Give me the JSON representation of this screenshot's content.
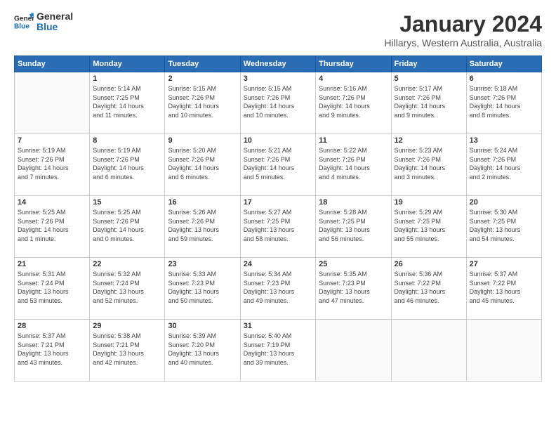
{
  "logo": {
    "line1": "General",
    "line2": "Blue"
  },
  "title": "January 2024",
  "subtitle": "Hillarys, Western Australia, Australia",
  "headers": [
    "Sunday",
    "Monday",
    "Tuesday",
    "Wednesday",
    "Thursday",
    "Friday",
    "Saturday"
  ],
  "weeks": [
    [
      {
        "day": "",
        "info": ""
      },
      {
        "day": "1",
        "info": "Sunrise: 5:14 AM\nSunset: 7:25 PM\nDaylight: 14 hours\nand 11 minutes."
      },
      {
        "day": "2",
        "info": "Sunrise: 5:15 AM\nSunset: 7:26 PM\nDaylight: 14 hours\nand 10 minutes."
      },
      {
        "day": "3",
        "info": "Sunrise: 5:15 AM\nSunset: 7:26 PM\nDaylight: 14 hours\nand 10 minutes."
      },
      {
        "day": "4",
        "info": "Sunrise: 5:16 AM\nSunset: 7:26 PM\nDaylight: 14 hours\nand 9 minutes."
      },
      {
        "day": "5",
        "info": "Sunrise: 5:17 AM\nSunset: 7:26 PM\nDaylight: 14 hours\nand 9 minutes."
      },
      {
        "day": "6",
        "info": "Sunrise: 5:18 AM\nSunset: 7:26 PM\nDaylight: 14 hours\nand 8 minutes."
      }
    ],
    [
      {
        "day": "7",
        "info": "Sunrise: 5:19 AM\nSunset: 7:26 PM\nDaylight: 14 hours\nand 7 minutes."
      },
      {
        "day": "8",
        "info": "Sunrise: 5:19 AM\nSunset: 7:26 PM\nDaylight: 14 hours\nand 6 minutes."
      },
      {
        "day": "9",
        "info": "Sunrise: 5:20 AM\nSunset: 7:26 PM\nDaylight: 14 hours\nand 6 minutes."
      },
      {
        "day": "10",
        "info": "Sunrise: 5:21 AM\nSunset: 7:26 PM\nDaylight: 14 hours\nand 5 minutes."
      },
      {
        "day": "11",
        "info": "Sunrise: 5:22 AM\nSunset: 7:26 PM\nDaylight: 14 hours\nand 4 minutes."
      },
      {
        "day": "12",
        "info": "Sunrise: 5:23 AM\nSunset: 7:26 PM\nDaylight: 14 hours\nand 3 minutes."
      },
      {
        "day": "13",
        "info": "Sunrise: 5:24 AM\nSunset: 7:26 PM\nDaylight: 14 hours\nand 2 minutes."
      }
    ],
    [
      {
        "day": "14",
        "info": "Sunrise: 5:25 AM\nSunset: 7:26 PM\nDaylight: 14 hours\nand 1 minute."
      },
      {
        "day": "15",
        "info": "Sunrise: 5:25 AM\nSunset: 7:26 PM\nDaylight: 14 hours\nand 0 minutes."
      },
      {
        "day": "16",
        "info": "Sunrise: 5:26 AM\nSunset: 7:26 PM\nDaylight: 13 hours\nand 59 minutes."
      },
      {
        "day": "17",
        "info": "Sunrise: 5:27 AM\nSunset: 7:25 PM\nDaylight: 13 hours\nand 58 minutes."
      },
      {
        "day": "18",
        "info": "Sunrise: 5:28 AM\nSunset: 7:25 PM\nDaylight: 13 hours\nand 56 minutes."
      },
      {
        "day": "19",
        "info": "Sunrise: 5:29 AM\nSunset: 7:25 PM\nDaylight: 13 hours\nand 55 minutes."
      },
      {
        "day": "20",
        "info": "Sunrise: 5:30 AM\nSunset: 7:25 PM\nDaylight: 13 hours\nand 54 minutes."
      }
    ],
    [
      {
        "day": "21",
        "info": "Sunrise: 5:31 AM\nSunset: 7:24 PM\nDaylight: 13 hours\nand 53 minutes."
      },
      {
        "day": "22",
        "info": "Sunrise: 5:32 AM\nSunset: 7:24 PM\nDaylight: 13 hours\nand 52 minutes."
      },
      {
        "day": "23",
        "info": "Sunrise: 5:33 AM\nSunset: 7:23 PM\nDaylight: 13 hours\nand 50 minutes."
      },
      {
        "day": "24",
        "info": "Sunrise: 5:34 AM\nSunset: 7:23 PM\nDaylight: 13 hours\nand 49 minutes."
      },
      {
        "day": "25",
        "info": "Sunrise: 5:35 AM\nSunset: 7:23 PM\nDaylight: 13 hours\nand 47 minutes."
      },
      {
        "day": "26",
        "info": "Sunrise: 5:36 AM\nSunset: 7:22 PM\nDaylight: 13 hours\nand 46 minutes."
      },
      {
        "day": "27",
        "info": "Sunrise: 5:37 AM\nSunset: 7:22 PM\nDaylight: 13 hours\nand 45 minutes."
      }
    ],
    [
      {
        "day": "28",
        "info": "Sunrise: 5:37 AM\nSunset: 7:21 PM\nDaylight: 13 hours\nand 43 minutes."
      },
      {
        "day": "29",
        "info": "Sunrise: 5:38 AM\nSunset: 7:21 PM\nDaylight: 13 hours\nand 42 minutes."
      },
      {
        "day": "30",
        "info": "Sunrise: 5:39 AM\nSunset: 7:20 PM\nDaylight: 13 hours\nand 40 minutes."
      },
      {
        "day": "31",
        "info": "Sunrise: 5:40 AM\nSunset: 7:19 PM\nDaylight: 13 hours\nand 39 minutes."
      },
      {
        "day": "",
        "info": ""
      },
      {
        "day": "",
        "info": ""
      },
      {
        "day": "",
        "info": ""
      }
    ]
  ]
}
